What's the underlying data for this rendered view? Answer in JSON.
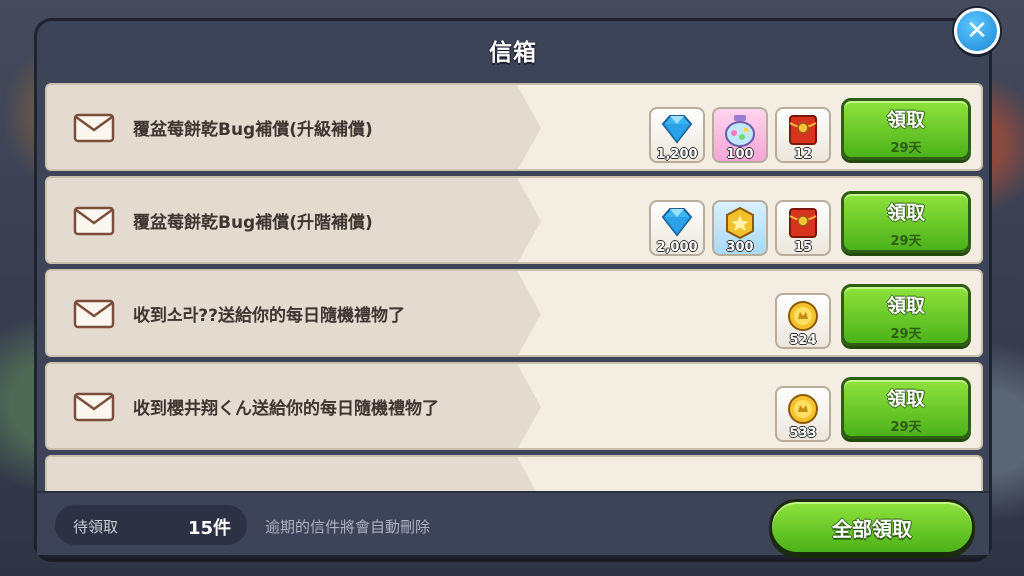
{
  "dialog": {
    "title": "信箱",
    "close_icon": "close-icon"
  },
  "mails": [
    {
      "subject": "覆盆莓餅乾Bug補償(升級補償)",
      "rewards": [
        {
          "icon": "crystal-icon",
          "count": "1,200"
        },
        {
          "icon": "potion-jar-icon",
          "count": "100"
        },
        {
          "icon": "red-envelope-icon",
          "count": "12"
        }
      ],
      "claim_label": "領取",
      "days_left": "29天"
    },
    {
      "subject": "覆盆莓餅乾Bug補償(升階補償)",
      "rewards": [
        {
          "icon": "crystal-icon",
          "count": "2,000"
        },
        {
          "icon": "gold-star-stone-icon",
          "count": "300"
        },
        {
          "icon": "red-envelope-icon",
          "count": "15"
        }
      ],
      "claim_label": "領取",
      "days_left": "29天"
    },
    {
      "subject": "收到소라??送給你的每日隨機禮物了",
      "rewards": [
        {
          "icon": "gold-coin-icon",
          "count": "524"
        }
      ],
      "claim_label": "領取",
      "days_left": "29天"
    },
    {
      "subject": "收到櫻井翔くん送給你的每日隨機禮物了",
      "rewards": [
        {
          "icon": "gold-coin-icon",
          "count": "533"
        }
      ],
      "claim_label": "領取",
      "days_left": "29天"
    }
  ],
  "footer": {
    "pending_label": "待領取",
    "pending_count": "15件",
    "expire_note": "逾期的信件將會自動刪除",
    "claim_all_label": "全部領取"
  }
}
